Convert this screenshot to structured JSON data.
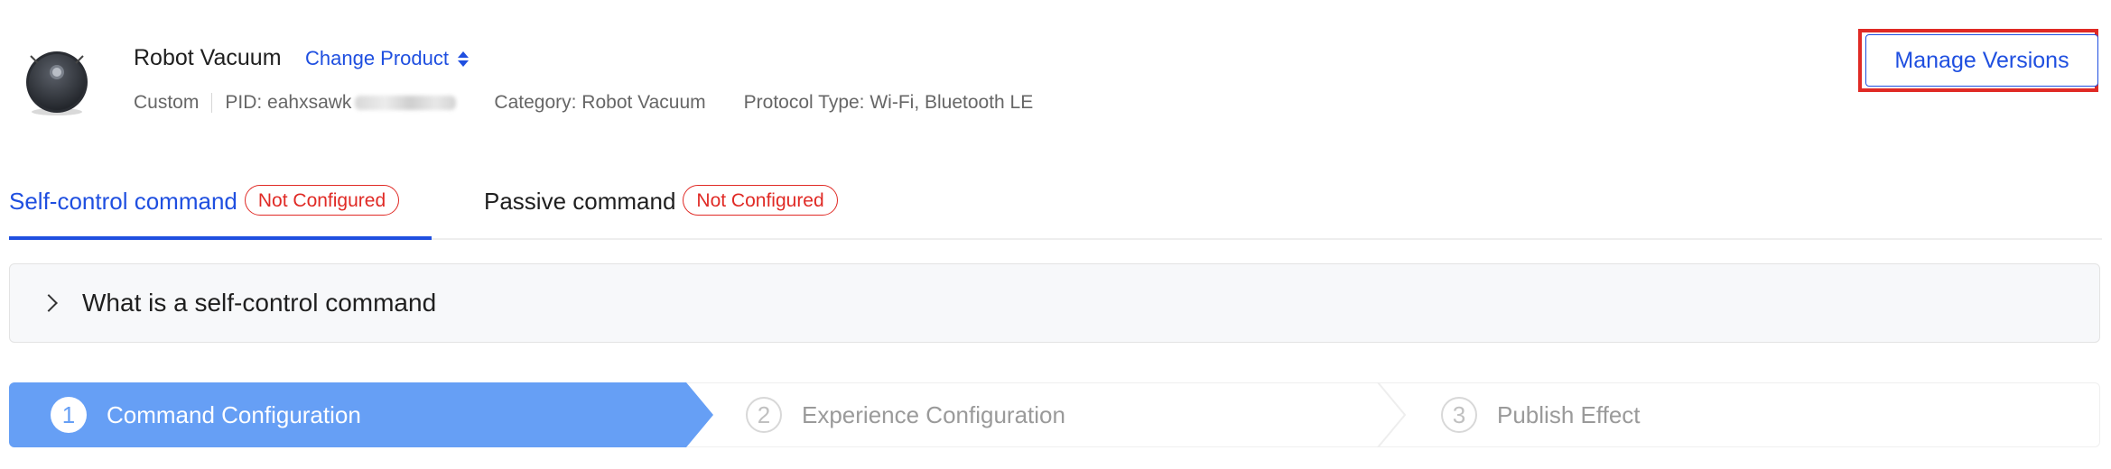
{
  "header": {
    "product_name": "Robot Vacuum",
    "change_product_label": "Change Product",
    "meta": {
      "type": "Custom",
      "pid": "PID: eahxsawk",
      "category": "Category: Robot Vacuum",
      "protocol": "Protocol Type: Wi-Fi, Bluetooth LE"
    },
    "manage_versions_label": "Manage Versions"
  },
  "tabs": [
    {
      "label": "Self-control command",
      "badge": "Not Configured",
      "active": true
    },
    {
      "label": "Passive command",
      "badge": "Not Configured",
      "active": false
    }
  ],
  "collapse_panel": {
    "title": "What is a self-control command"
  },
  "steps": [
    {
      "number": "1",
      "label": "Command Configuration",
      "active": true
    },
    {
      "number": "2",
      "label": "Experience Configuration",
      "active": false
    },
    {
      "number": "3",
      "label": "Publish Effect",
      "active": false
    }
  ],
  "colors": {
    "primary": "#1f4fe0",
    "danger": "#e02a25",
    "step_active": "#669ff5",
    "panel_bg": "#f7f8fa"
  }
}
